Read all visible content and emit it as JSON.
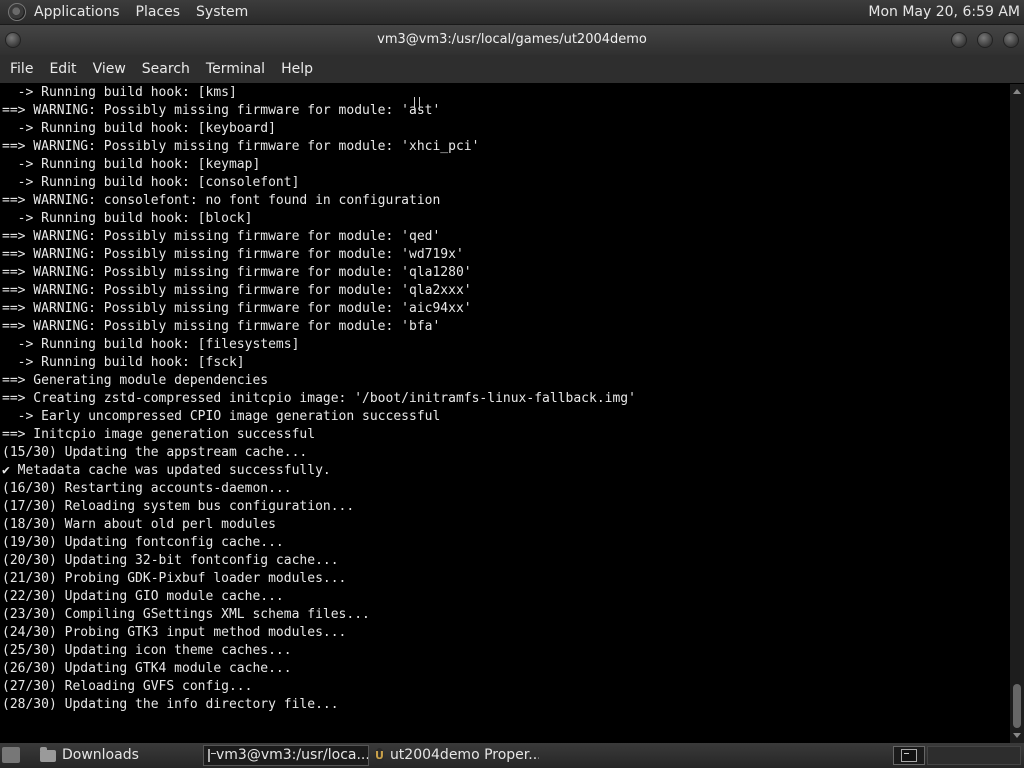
{
  "top_panel": {
    "menus": [
      "Applications",
      "Places",
      "System"
    ],
    "clock": "Mon May 20,  6:59 AM"
  },
  "window": {
    "title": "vm3@vm3:/usr/local/games/ut2004demo",
    "menu": [
      "File",
      "Edit",
      "View",
      "Search",
      "Terminal",
      "Help"
    ]
  },
  "terminal": {
    "lines": [
      "  -> Running build hook: [kms]",
      "==> WARNING: Possibly missing firmware for module: 'ast'",
      "  -> Running build hook: [keyboard]",
      "==> WARNING: Possibly missing firmware for module: 'xhci_pci'",
      "  -> Running build hook: [keymap]",
      "  -> Running build hook: [consolefont]",
      "==> WARNING: consolefont: no font found in configuration",
      "  -> Running build hook: [block]",
      "==> WARNING: Possibly missing firmware for module: 'qed'",
      "==> WARNING: Possibly missing firmware for module: 'wd719x'",
      "==> WARNING: Possibly missing firmware for module: 'qla1280'",
      "==> WARNING: Possibly missing firmware for module: 'qla2xxx'",
      "==> WARNING: Possibly missing firmware for module: 'aic94xx'",
      "==> WARNING: Possibly missing firmware for module: 'bfa'",
      "  -> Running build hook: [filesystems]",
      "  -> Running build hook: [fsck]",
      "==> Generating module dependencies",
      "==> Creating zstd-compressed initcpio image: '/boot/initramfs-linux-fallback.img'",
      "  -> Early uncompressed CPIO image generation successful",
      "==> Initcpio image generation successful",
      "(15/30) Updating the appstream cache...",
      "✔ Metadata cache was updated successfully.",
      "(16/30) Restarting accounts-daemon...",
      "(17/30) Reloading system bus configuration...",
      "(18/30) Warn about old perl modules",
      "(19/30) Updating fontconfig cache...",
      "(20/30) Updating 32-bit fontconfig cache...",
      "(21/30) Probing GDK-Pixbuf loader modules...",
      "(22/30) Updating GIO module cache...",
      "(23/30) Compiling GSettings XML schema files...",
      "(24/30) Probing GTK3 input method modules...",
      "(25/30) Updating icon theme caches...",
      "(26/30) Updating GTK4 module cache...",
      "(27/30) Reloading GVFS config...",
      "(28/30) Updating the info directory file..."
    ]
  },
  "taskbar": {
    "tasks": [
      {
        "label": "Downloads",
        "icon": "folder-icon"
      },
      {
        "label": "vm3@vm3:/usr/loca...",
        "icon": "terminal-icon"
      },
      {
        "label": "ut2004demo Proper...",
        "icon": "ut-icon"
      }
    ]
  }
}
